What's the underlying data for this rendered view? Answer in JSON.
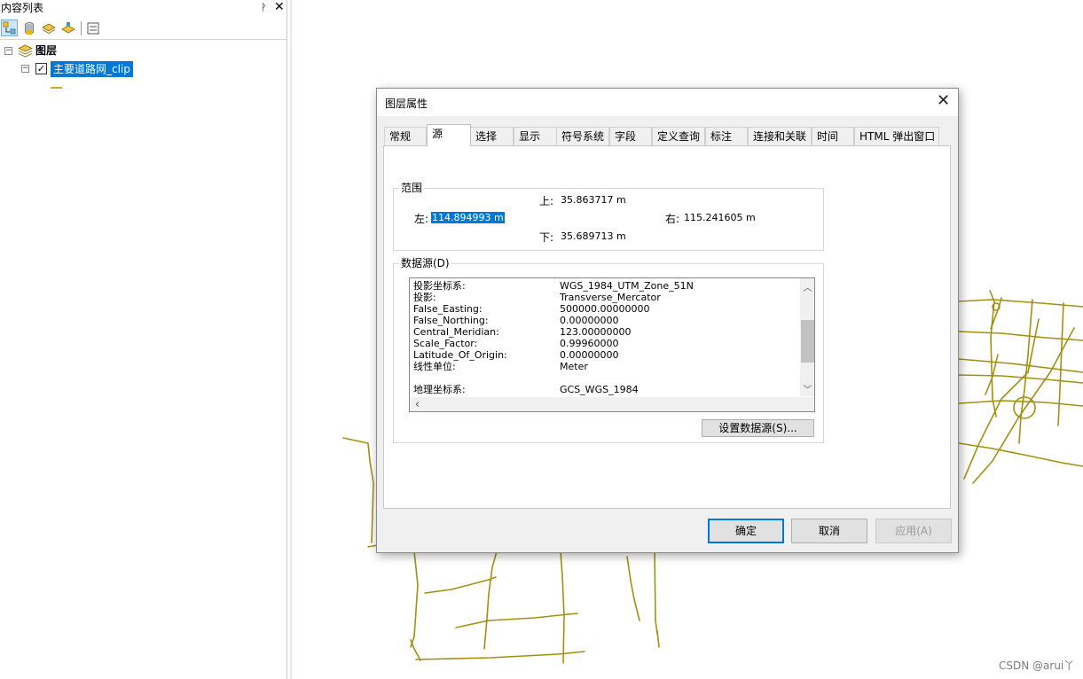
{
  "toc": {
    "title": "内容列表",
    "pin_glyph": "ᚹ",
    "close_glyph": "✕",
    "toolbar": [
      {
        "name": "list-by-drawing-order-icon"
      },
      {
        "name": "list-by-source-icon"
      },
      {
        "name": "list-by-visibility-icon"
      },
      {
        "name": "list-by-selection-icon"
      },
      {
        "name": "options-icon"
      }
    ],
    "root_label": "图层",
    "layer_label": "主要道路网_clip",
    "layer_checked": true,
    "legend_color": "#e0a22c"
  },
  "map": {
    "road_color": "#a49010",
    "watermark": "CSDN @arui丫"
  },
  "dialog": {
    "title": "图层属性",
    "close_glyph": "✕",
    "tabs": [
      {
        "label": "常规"
      },
      {
        "label": "源"
      },
      {
        "label": "选择"
      },
      {
        "label": "显示"
      },
      {
        "label": "符号系统"
      },
      {
        "label": "字段"
      },
      {
        "label": "定义查询"
      },
      {
        "label": "标注"
      },
      {
        "label": "连接和关联"
      },
      {
        "label": "时间"
      },
      {
        "label": "HTML 弹出窗口"
      }
    ],
    "active_tab": "源",
    "extent": {
      "legend": "范围",
      "top_label": "上:",
      "top_value": "35.863717 m",
      "left_label": "左:",
      "left_value": "114.894993 m",
      "right_label": "右:",
      "right_value": "115.241605 m",
      "bottom_label": "下:",
      "bottom_value": "35.689713 m"
    },
    "datasource": {
      "legend": "数据源(D)",
      "rows": [
        {
          "key": "投影坐标系:",
          "value": "WGS_1984_UTM_Zone_51N"
        },
        {
          "key": "投影:",
          "value": "Transverse_Mercator"
        },
        {
          "key": "False_Easting:",
          "value": "500000.00000000"
        },
        {
          "key": "False_Northing:",
          "value": "0.00000000"
        },
        {
          "key": "Central_Meridian:",
          "value": "123.00000000"
        },
        {
          "key": "Scale_Factor:",
          "value": "0.99960000"
        },
        {
          "key": "Latitude_Of_Origin:",
          "value": "0.00000000"
        },
        {
          "key": "线性单位:",
          "value": "Meter"
        },
        {
          "key": "",
          "value": ""
        },
        {
          "key": "地理坐标系:",
          "value": "GCS_WGS_1984"
        }
      ],
      "scroll_up": "︿",
      "scroll_down": "﹀",
      "scroll_left": "‹",
      "set_source_button": "设置数据源(S)..."
    },
    "buttons": {
      "ok": "确定",
      "cancel": "取消",
      "apply": "应用(A)"
    }
  }
}
